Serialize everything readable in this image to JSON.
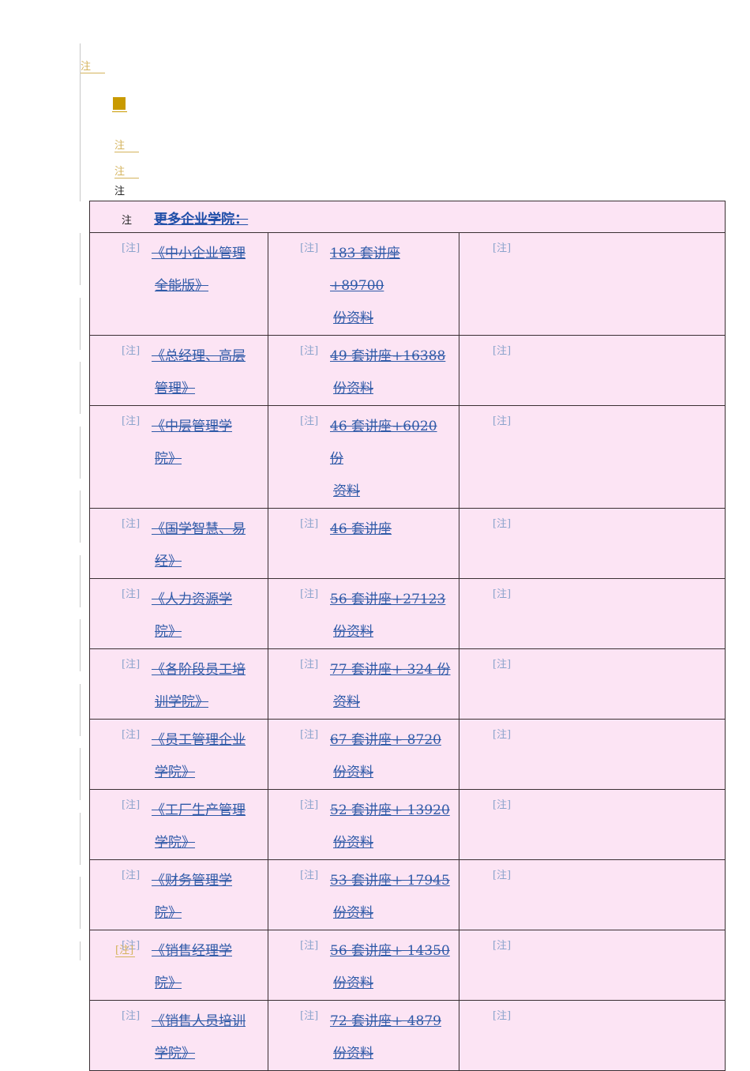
{
  "top_notes": {
    "note1": "注",
    "note2": "注",
    "note3": "注",
    "note4": "注"
  },
  "table": {
    "header_note": "注",
    "header_link": "更多企业学院：",
    "ref_label": "[注]",
    "rows": [
      {
        "title_line1": "《中小企业管理",
        "title_line2": "全能版》",
        "detail_line1": "183 套讲座+89700",
        "detail_line2": "份资料"
      },
      {
        "title_line1": "《总经理、高层",
        "title_line2": "管理》",
        "detail_line1": "49 套讲座+16388",
        "detail_line2": "份资料"
      },
      {
        "title_line1": "《中层管理学",
        "title_line2": "院》",
        "detail_line1": "46 套讲座+6020 份",
        "detail_line2": "资料"
      },
      {
        "title_line1": "《国学智慧、易",
        "title_line2": "经》",
        "detail_line1": "46 套讲座",
        "detail_line2": ""
      },
      {
        "title_line1": "《人力资源学",
        "title_line2": "院》",
        "detail_line1": "56 套讲座+27123",
        "detail_line2": "份资料"
      },
      {
        "title_line1": "《各阶段员工培",
        "title_line2": "训学院》",
        "detail_line1": "77 套讲座+ 324 份",
        "detail_line2": "资料"
      },
      {
        "title_line1": "《员工管理企业",
        "title_line2": "学院》",
        "detail_line1": "67 套讲座+ 8720",
        "detail_line2": "份资料"
      },
      {
        "title_line1": "《工厂生产管理",
        "title_line2": "学院》",
        "detail_line1": "52 套讲座+ 13920",
        "detail_line2": "份资料"
      },
      {
        "title_line1": "《财务管理学",
        "title_line2": "院》",
        "detail_line1": "53 套讲座+ 17945",
        "detail_line2": "份资料"
      },
      {
        "title_line1": "《销售经理学",
        "title_line2": "院》",
        "detail_line1": "56 套讲座+ 14350",
        "detail_line2": "份资料"
      },
      {
        "title_line1": "《销售人员培训",
        "title_line2": "学院》",
        "detail_line1": "72 套讲座+ 4879",
        "detail_line2": "份资料"
      }
    ]
  },
  "footer_ref": "[注]",
  "colors": {
    "table_bg": "#fce4f4",
    "link": "#2f5aa8",
    "note_gold": "#d4b35c",
    "bullet": "#c99a00"
  }
}
